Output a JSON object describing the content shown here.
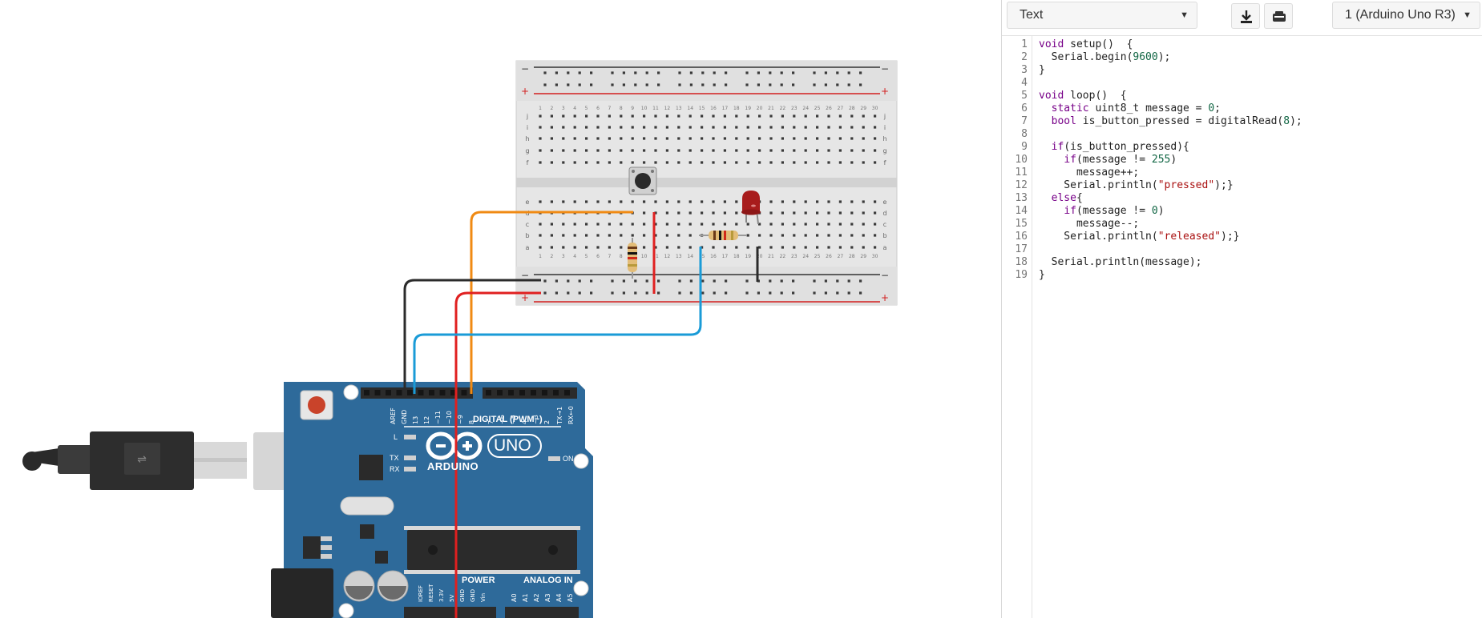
{
  "toolbar": {
    "mode_select": "Text",
    "download_icon": "download-icon",
    "serial_icon": "serial-monitor-icon",
    "device_select": "1 (Arduino Uno R3)"
  },
  "code_lines": [
    "void setup()  {",
    "  Serial.begin(9600);",
    "}",
    "",
    "void loop()  {",
    "  static uint8_t message = 0;",
    "  bool is_button_pressed = digitalRead(8);",
    "",
    "  if(is_button_pressed){",
    "    if(message != 255)",
    "      message++;",
    "    Serial.println(\"pressed\");}",
    "  else{",
    "    if(message != 0)",
    "      message--;",
    "    Serial.println(\"released\");}",
    "",
    "  Serial.println(message);",
    "}"
  ],
  "breadboard": {
    "row_letters_top": [
      "j",
      "i",
      "h",
      "g",
      "f"
    ],
    "row_letters_bottom": [
      "e",
      "d",
      "c",
      "b",
      "a"
    ],
    "rail_minus": "−",
    "rail_plus": "+"
  },
  "arduino": {
    "brand": "ARDUINO",
    "model": "UNO",
    "digital_label": "DIGITAL (PWM~)",
    "power_label": "POWER",
    "analog_label": "ANALOG IN",
    "on_label": "ON",
    "l_label": "L",
    "tx_label": "TX",
    "rx_label": "RX",
    "top_pins": [
      "AREF",
      "GND",
      "13",
      "12",
      "~11",
      "~10",
      "~9",
      "8",
      "7",
      "~6",
      "~5",
      "4",
      "~3",
      "2",
      "TX→1",
      "RX←0"
    ],
    "power_pins": [
      "IOREF",
      "RESET",
      "3.3V",
      "5V",
      "GND",
      "GND",
      "Vin"
    ],
    "analog_pins": [
      "A0",
      "A1",
      "A2",
      "A3",
      "A4",
      "A5"
    ]
  },
  "colors": {
    "board_blue": "#2e6a9a",
    "wire_orange": "#f08a13",
    "wire_black": "#2b2b2b",
    "wire_red": "#e02020",
    "wire_blue": "#1a9bd7",
    "led_red": "#a81c1c"
  }
}
